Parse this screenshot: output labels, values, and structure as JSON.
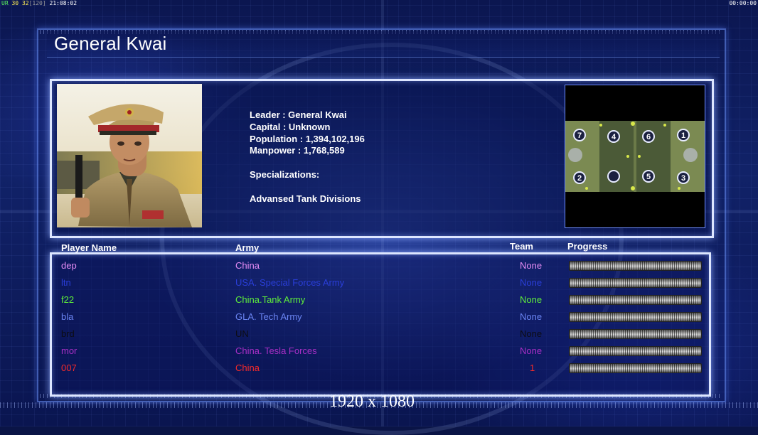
{
  "status_bar": {
    "left_prefix": "UR",
    "fps_a": "30",
    "fps_b": "32",
    "fps_c": "[120]",
    "clock": "21:08:02",
    "right_timer": "00:00:00"
  },
  "title": "General Kwai",
  "info": {
    "leader": "Leader : General Kwai",
    "capital": "Capital : Unknown",
    "population": "Population : 1,394,102,196",
    "manpower": "Manpower : 1,768,589",
    "specializations_label": "Specializations:",
    "specialization": "Advansed Tank Divisions"
  },
  "minimap": {
    "slots": [
      "7",
      "4",
      "6",
      "1",
      "2",
      "",
      "5",
      "3"
    ]
  },
  "table": {
    "headers": {
      "player_name": "Player Name",
      "army": "Army",
      "team": "Team",
      "progress": "Progress"
    },
    "rows": [
      {
        "name": "dep",
        "army": "China",
        "team": "None",
        "color": "#e58cf5"
      },
      {
        "name": "ltn",
        "army": "USA. Special Forces Army",
        "team": "None",
        "color": "#2a3ed8"
      },
      {
        "name": "f22",
        "army": "China.Tank Army",
        "team": "None",
        "color": "#5ff03a"
      },
      {
        "name": "bla",
        "army": "GLA. Tech Army",
        "team": "None",
        "color": "#6a84f2"
      },
      {
        "name": "brd",
        "army": "UN",
        "team": "None",
        "color": "#0c0c14"
      },
      {
        "name": "mor",
        "army": "China. Tesla Forces",
        "team": "None",
        "color": "#a92fc6"
      },
      {
        "name": "007",
        "army": "China",
        "team": "1",
        "color": "#f52a2a"
      }
    ]
  },
  "resolution_label": "1920 x 1080"
}
